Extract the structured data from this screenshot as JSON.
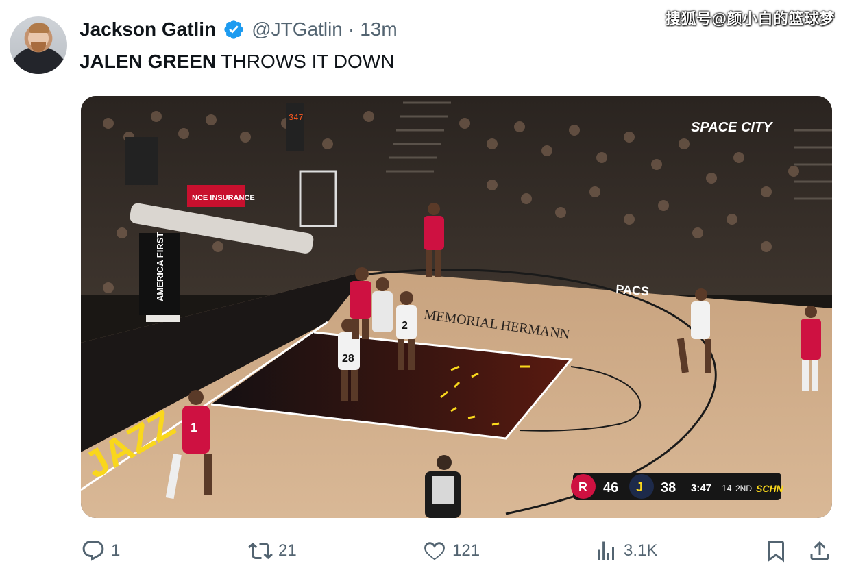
{
  "author": {
    "name": "Jackson Gatlin",
    "handle": "@JTGatlin",
    "separator": "·",
    "time": "13m",
    "verified": true
  },
  "watermark": "搜狐号@颜小白的篮球梦",
  "tweet": {
    "bold": "JALEN GREEN",
    "rest": " THROWS IT DOWN"
  },
  "media": {
    "scorebug": {
      "home_score": "46",
      "away_score": "38",
      "clock": "3:47",
      "shot_clock": "14",
      "quarter": "2ND",
      "network": "SCHN",
      "home_logo": "rockets-logo",
      "away_logo": "jazz-logo"
    },
    "court_text": {
      "center": "MEMORIAL HERMANN",
      "sideline": "PACS",
      "baseline": "JAZZ",
      "arena_sign": "SPACE CITY",
      "stanchion": "AMERICA FIRST",
      "ad_board": "NCE INSURANCE",
      "shot_clock_display": "347"
    },
    "jerseys": [
      "28",
      "2",
      "1"
    ]
  },
  "actions": {
    "replies": "1",
    "retweets": "21",
    "likes": "121",
    "views": "3.1K"
  },
  "icons": {
    "reply": "reply-icon",
    "retweet": "retweet-icon",
    "like": "heart-icon",
    "views": "views-icon",
    "bookmark": "bookmark-icon",
    "share": "share-icon"
  },
  "colors": {
    "verified": "#1d9bf0",
    "text_primary": "#0f1419",
    "text_secondary": "#536471",
    "rockets_red": "#ce1141",
    "jazz_yellow": "#f9d71c"
  }
}
